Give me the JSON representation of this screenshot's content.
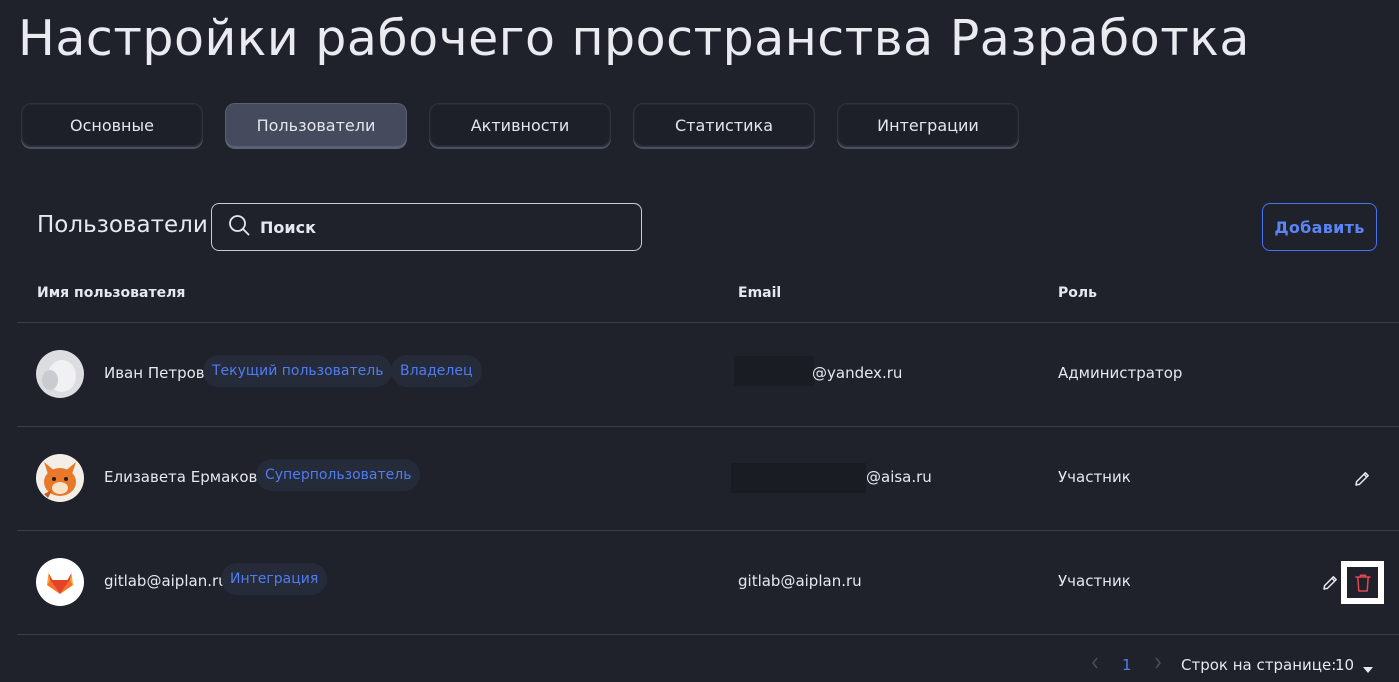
{
  "page_title": "Настройки рабочего пространства Разработка",
  "tabs": [
    "Основные",
    "Пользователи",
    "Активности",
    "Статистика",
    "Интеграции"
  ],
  "users_section": {
    "title": "Пользователи",
    "search_placeholder": "Поиск",
    "add_label": "Добавить"
  },
  "table": {
    "headers": {
      "name": "Имя пользователя",
      "email": "Email",
      "role": "Роль"
    },
    "rows": [
      {
        "name": "Иван Петров",
        "badges": [
          "Текущий пользователь",
          "Владелец"
        ],
        "email": "@yandex.ru",
        "role": "Администратор",
        "can_edit": false,
        "can_delete": false
      },
      {
        "name": "Елизавета Ермакова",
        "badges": [
          "Суперпользователь"
        ],
        "email": "@aisa.ru",
        "role": "Участник",
        "can_edit": true,
        "can_delete": false
      },
      {
        "name": "gitlab@aiplan.ru",
        "badges": [
          "Интеграция"
        ],
        "email": "gitlab@aiplan.ru",
        "role": "Участник",
        "can_edit": true,
        "can_delete": true
      }
    ]
  },
  "pagination": {
    "current_page": "1",
    "rows_per_page_label": "Строк на странице:",
    "rows_per_page_value": "10"
  },
  "colors": {
    "background": "#1f222b",
    "accent": "#4f7cf0",
    "danger": "#e5484d",
    "gitlab_orange": "#e24329"
  }
}
